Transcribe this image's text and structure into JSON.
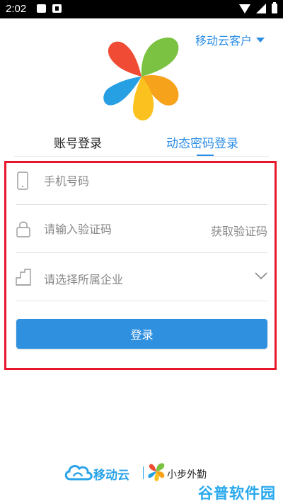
{
  "status_bar": {
    "time": "2:02",
    "icons": [
      "image-icon",
      "app-icon",
      "wifi-icon",
      "cell-signal-icon",
      "battery-icon"
    ]
  },
  "header": {
    "customer_type": "移动云客户",
    "customer_caret_icon": "caret-down-icon"
  },
  "logo": {
    "name": "pinwheel-logo"
  },
  "tabs": [
    {
      "label": "账号登录",
      "active": false
    },
    {
      "label": "动态密码登录",
      "active": true
    }
  ],
  "form": {
    "phone": {
      "placeholder": "手机号码",
      "value": "",
      "icon": "phone-icon"
    },
    "verification": {
      "placeholder": "请输入验证码",
      "value": "",
      "icon": "lock-icon",
      "action_label": "获取验证码"
    },
    "company": {
      "placeholder": "请选择所属企业",
      "icon": "building-icon",
      "dropdown_icon": "chevron-down-icon"
    },
    "submit_label": "登录"
  },
  "footer": {
    "brand_primary": "移动云",
    "brand_secondary": "小步外勤"
  },
  "watermark": "谷普软件园",
  "colors": {
    "accent": "#2d8ee6",
    "button": "#2f90e0",
    "highlight_frame": "#e8172b",
    "status_bar": "#000000"
  }
}
